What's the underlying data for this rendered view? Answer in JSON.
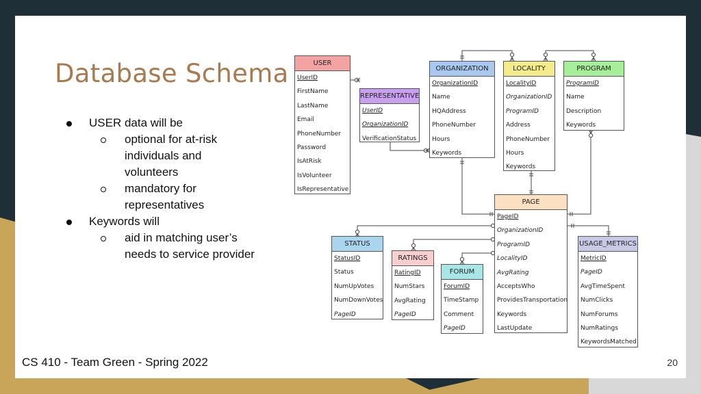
{
  "slide": {
    "title": "Database Schema",
    "footer": "CS 410 - Team Green - Spring 2022",
    "page_number": "20"
  },
  "bullets": [
    {
      "level": 1,
      "text": "USER data will be"
    },
    {
      "level": 2,
      "text": "optional for at-risk"
    },
    {
      "level": 2,
      "text": "individuals and",
      "continuation": true
    },
    {
      "level": 2,
      "text": "volunteers",
      "continuation": true
    },
    {
      "level": 2,
      "text": "mandatory for"
    },
    {
      "level": 2,
      "text": "representatives",
      "continuation": true
    },
    {
      "level": 1,
      "text": "Keywords will"
    },
    {
      "level": 2,
      "text": "aid in matching user’s"
    },
    {
      "level": 2,
      "text": "needs to service provider",
      "continuation": true
    }
  ],
  "entities": {
    "user": {
      "name": "USER",
      "color": "#f4a3a3",
      "fields": [
        "UserID",
        "FirstName",
        "LastName",
        "Email",
        "PhoneNumber",
        "Password",
        "IsAtRisk",
        "IsVolunteer",
        "IsRepresentative"
      ]
    },
    "representative": {
      "name": "REPRESENTATIVE",
      "color": "#c9a0f0",
      "fields": [
        "UserID",
        "OrganizationID",
        "VerificationStatus"
      ]
    },
    "organization": {
      "name": "ORGANIZATION",
      "color": "#a9c8f0",
      "fields": [
        "OrganizationID",
        "Name",
        "HQAddress",
        "PhoneNumber",
        "Hours",
        "Keywords"
      ]
    },
    "locality": {
      "name": "LOCALITY",
      "color": "#f4ec8c",
      "fields": [
        "LocalityID",
        "OrganizationID",
        "ProgramID",
        "Address",
        "PhoneNumber",
        "Hours",
        "Keywords"
      ]
    },
    "program": {
      "name": "PROGRAM",
      "color": "#a6ee9a",
      "fields": [
        "ProgramID",
        "Name",
        "Description",
        "Keywords"
      ]
    },
    "page": {
      "name": "PAGE",
      "color": "#fbe0c2",
      "fields": [
        "PageID",
        "OrganizationID",
        "ProgramID",
        "LocalityID",
        "AvgRating",
        "AcceptsWho",
        "ProvidesTransportation",
        "Keywords",
        "LastUpdate"
      ]
    },
    "status": {
      "name": "STATUS",
      "color": "#a9d6ee",
      "fields": [
        "StatusID",
        "Status",
        "NumUpVotes",
        "NumDownVotes",
        "PageID"
      ]
    },
    "ratings": {
      "name": "RATINGS",
      "color": "#f8cfcf",
      "fields": [
        "RatingID",
        "NumStars",
        "AvgRating",
        "PageID"
      ]
    },
    "forum": {
      "name": "FORUM",
      "color": "#a9e6e6",
      "fields": [
        "ForumID",
        "TimeStamp",
        "Comment",
        "PageID"
      ]
    },
    "usage_metrics": {
      "name": "USAGE_METRICS",
      "color": "#c9c9e6",
      "fields": [
        "MetricID",
        "PageID",
        "AvgTimeSpent",
        "NumClicks",
        "NumForums",
        "NumRatings",
        "KeywordsMatched"
      ]
    }
  }
}
